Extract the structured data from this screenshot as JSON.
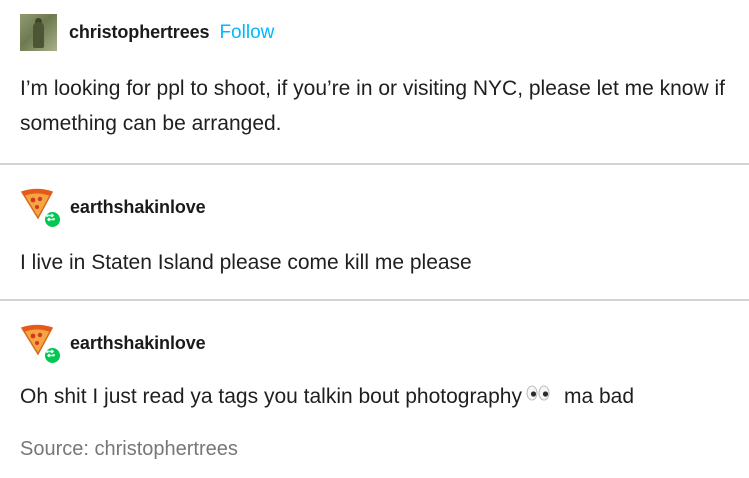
{
  "original_post": {
    "username": "christophertrees",
    "follow_label": "Follow",
    "text": "I’m looking for ppl to shoot, if you’re in or visiting NYC, please let me know if something can be arranged."
  },
  "reblogs": [
    {
      "username": "earthshakinlove",
      "text": "I live in Staten Island please come kill me please"
    },
    {
      "username": "earthshakinlove",
      "text_before_emoji": "Oh shit I just read ya tags you talkin bout photography",
      "emoji_icon": "eyes-emoji",
      "text_after_emoji": "ma bad"
    }
  ],
  "source": {
    "label": "Source:",
    "name": "christophertrees"
  },
  "colors": {
    "follow": "#00b8ff",
    "reblog_badge": "#00c853",
    "divider": "#d4d4d4",
    "source_text": "#777777"
  }
}
